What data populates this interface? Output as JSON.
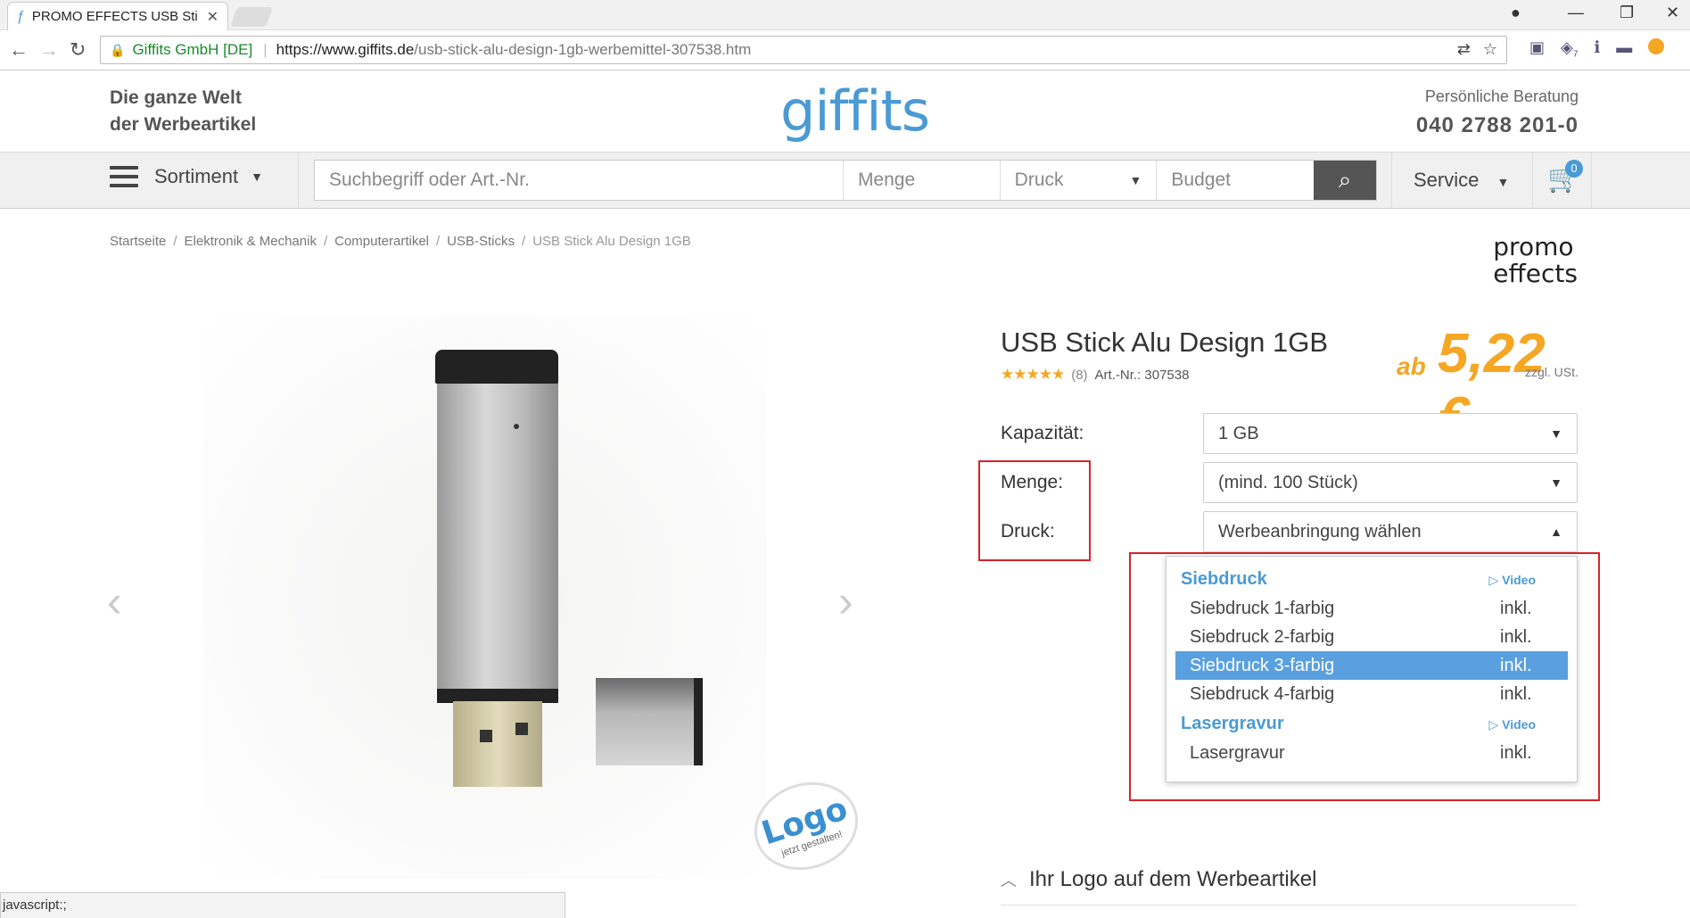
{
  "browser": {
    "tab_title": "PROMO EFFECTS USB Sti",
    "site_identity": "Giffits GmbH [DE]",
    "url_host": "https://www.giffits.de",
    "url_path": "/usb-stick-alu-design-1gb-werbemittel-307538.htm",
    "ext_badge": "7"
  },
  "header": {
    "tagline_line1": "Die ganze Welt",
    "tagline_line2": "der Werbeartikel",
    "logo_text": "giffits",
    "contact_label": "Persönliche Beratung",
    "phone": "040 2788 201-0"
  },
  "nav": {
    "sortiment": "Sortiment",
    "search_placeholder": "Suchbegriff oder Art.-Nr.",
    "menge_placeholder": "Menge",
    "druck_label": "Druck",
    "budget_placeholder": "Budget",
    "service": "Service",
    "cart_count": "0"
  },
  "breadcrumb": [
    "Startseite",
    "Elektronik & Mechanik",
    "Computerartikel",
    "USB-Sticks",
    "USB Stick Alu Design 1GB"
  ],
  "brand": {
    "line1": "promo",
    "line2": "effects"
  },
  "product": {
    "title": "USB Stick Alu Design 1GB",
    "rating": 4.5,
    "stars": "★★★★★",
    "review_count": "(8)",
    "art_nr": "Art.-Nr.: 307538",
    "price_prefix": "ab",
    "price": "5,22 €",
    "price_note": "zzgl. USt.",
    "image_badge_big": "Logo",
    "image_badge_small": "jetzt gestalten!"
  },
  "options": {
    "kapazitaet_label": "Kapazität:",
    "kapazitaet_value": "1 GB",
    "menge_label": "Menge:",
    "menge_value": "(mind. 100 Stück)",
    "druck_label": "Druck:",
    "druck_value": "Werbeanbringung wählen"
  },
  "dropdown": {
    "groups": [
      {
        "name": "Siebdruck",
        "video": "Video",
        "items": [
          {
            "name": "Siebdruck 1-farbig",
            "price": "inkl.",
            "selected": false
          },
          {
            "name": "Siebdruck 2-farbig",
            "price": "inkl.",
            "selected": false
          },
          {
            "name": "Siebdruck 3-farbig",
            "price": "inkl.",
            "selected": true
          },
          {
            "name": "Siebdruck 4-farbig",
            "price": "inkl.",
            "selected": false
          }
        ]
      },
      {
        "name": "Lasergravur",
        "video": "Video",
        "items": [
          {
            "name": "Lasergravur",
            "price": "inkl.",
            "selected": false
          }
        ]
      }
    ]
  },
  "logo_section": "Ihr Logo auf dem Werbeartikel",
  "status_bar": "javascript:;",
  "colors": {
    "accent": "#4a9ad4",
    "price": "#f5a623",
    "highlight": "#d6232b",
    "selected": "#5aa0de"
  }
}
